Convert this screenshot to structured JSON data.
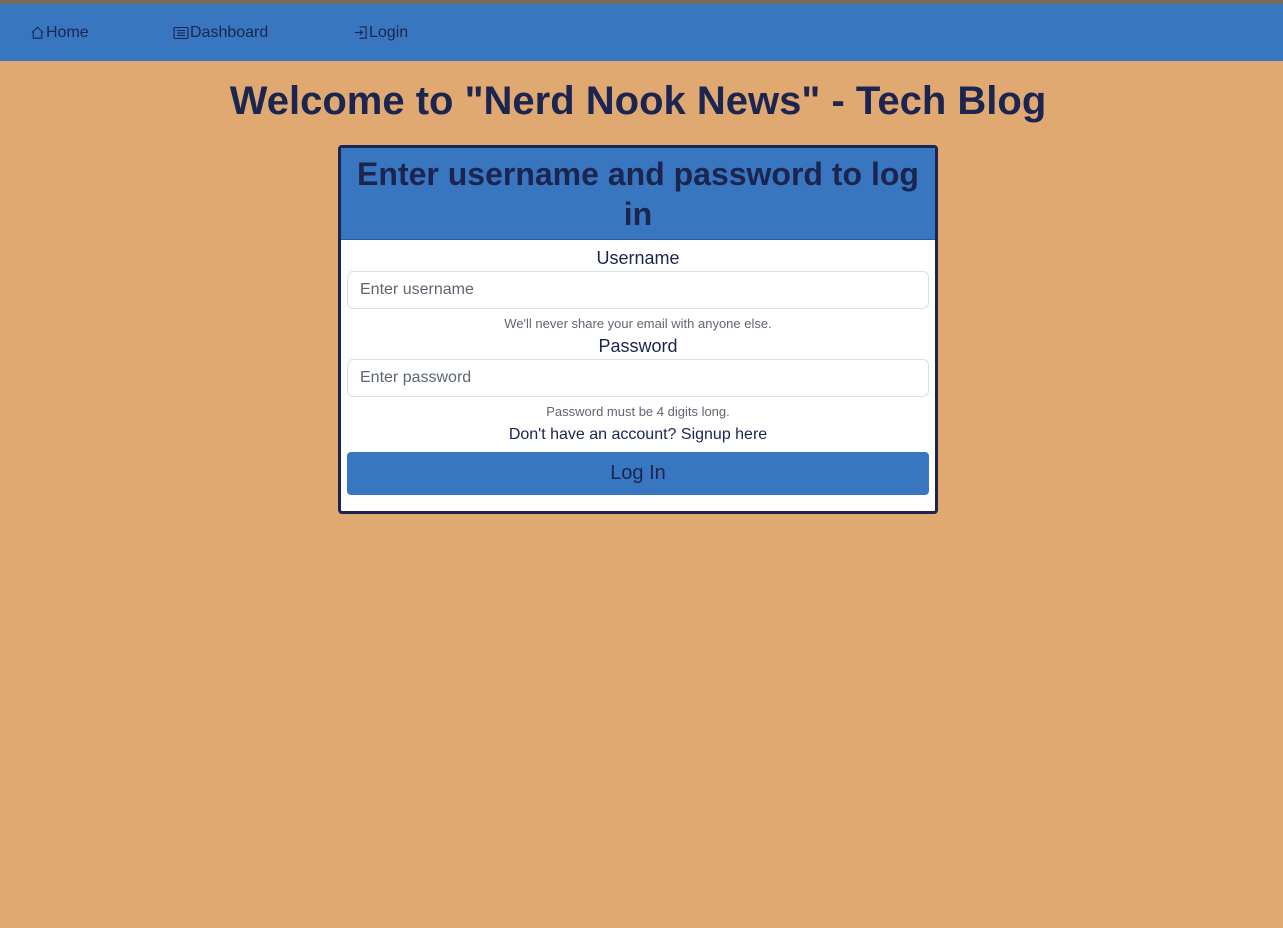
{
  "nav": {
    "items": [
      {
        "label": "Home",
        "icon": "home-icon"
      },
      {
        "label": "Dashboard",
        "icon": "list-icon"
      },
      {
        "label": "Login",
        "icon": "login-icon"
      }
    ]
  },
  "page": {
    "title": "Welcome to \"Nerd Nook News\" - Tech Blog"
  },
  "login_form": {
    "heading": "Enter username and password to log in",
    "username_label": "Username",
    "username_placeholder": "Enter username",
    "username_help": "We'll never share your email with anyone else.",
    "password_label": "Password",
    "password_placeholder": "Enter password",
    "password_help": "Password must be 4 digits long.",
    "signup_prompt": "Don't have an account?",
    "signup_link": "Signup here",
    "submit_label": "Log In"
  },
  "colors": {
    "background": "#e0a972",
    "navbar": "#3976c0",
    "text": "#1c2450",
    "button": "#3976c0"
  }
}
